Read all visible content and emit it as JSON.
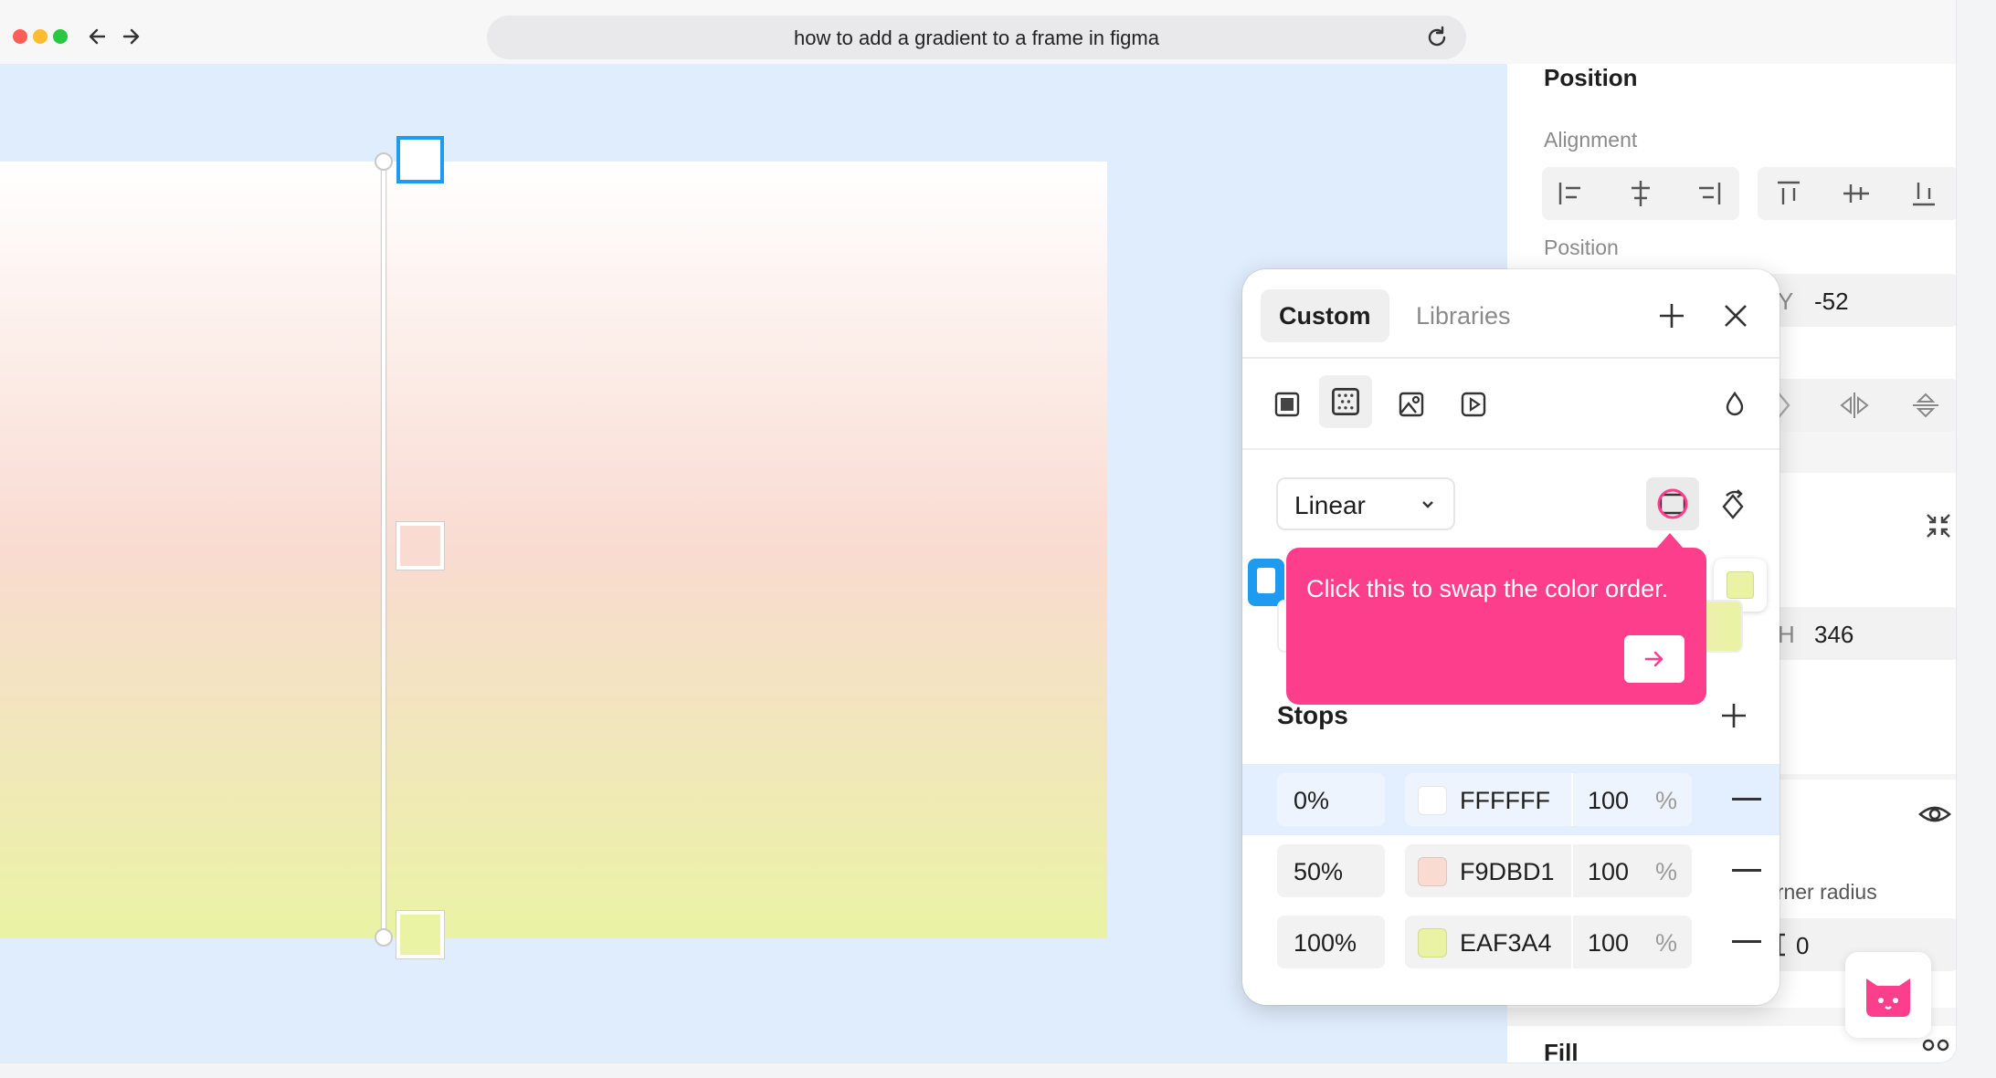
{
  "browser": {
    "url": "how to add a gradient to a frame in figma",
    "traffic_lights": [
      "#ff5f57",
      "#febc2e",
      "#28c840"
    ]
  },
  "canvas": {
    "gradient_colors": [
      "#ffffff",
      "#f9dbd1",
      "#eaf3a4"
    ]
  },
  "right_panel": {
    "position_title": "Position",
    "alignment_label": "Alignment",
    "position_label": "Position",
    "y_label": "Y",
    "y_value": "-52",
    "h_label": "H",
    "h_value": "346",
    "corner_radius_label": "orner radius",
    "corner_radius_value": "0",
    "fill_title": "Fill"
  },
  "picker": {
    "tabs": [
      "Custom",
      "Libraries"
    ],
    "gradient_type": "Linear",
    "stops_title": "Stops",
    "stops": [
      {
        "position": "0%",
        "hex": "FFFFFF",
        "opacity": "100",
        "unit": "%",
        "color": "#ffffff"
      },
      {
        "position": "50%",
        "hex": "F9DBD1",
        "opacity": "100",
        "unit": "%",
        "color": "#f9dbd1"
      },
      {
        "position": "100%",
        "hex": "EAF3A4",
        "opacity": "100",
        "unit": "%",
        "color": "#eaf3a4"
      }
    ]
  },
  "tooltip": {
    "text": "Click this to swap the color order.",
    "color": "#fd3e8c"
  }
}
